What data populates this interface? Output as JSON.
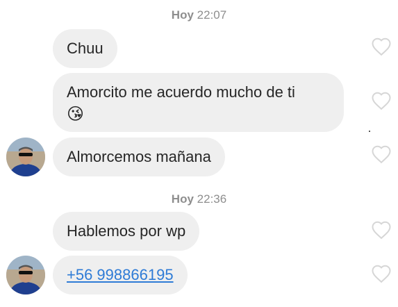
{
  "timestamps": [
    {
      "day": "Hoy",
      "time": "22:07"
    },
    {
      "day": "Hoy",
      "time": "22:36"
    }
  ],
  "messages": [
    {
      "text": "Chuu"
    },
    {
      "text": "Amorcito me acuerdo mucho de ti",
      "emoji": "😘"
    },
    {
      "text": "Almorcemos mañana"
    },
    {
      "text": "Hablemos por wp"
    },
    {
      "text": "+56 998866195"
    }
  ],
  "colors": {
    "bubble_bg": "#efefef",
    "text": "#262626",
    "timestamp": "#8e8e8e",
    "link": "#2e7bd6",
    "heart_outline": "#d6d6d6"
  },
  "icons": {
    "like": "heart-outline-icon",
    "emoji": "face-blowing-kiss"
  }
}
